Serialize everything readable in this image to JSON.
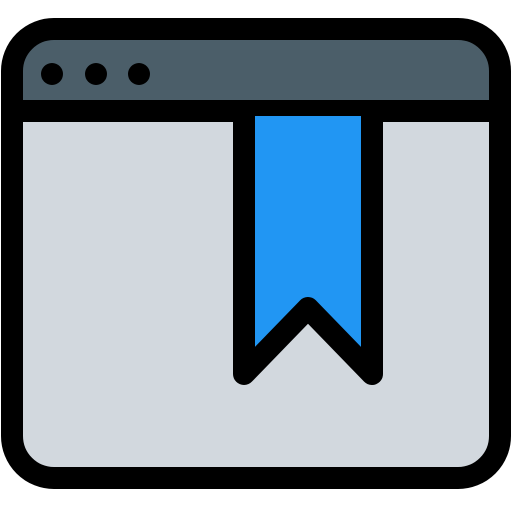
{
  "icon": {
    "name": "browser-bookmark-icon",
    "window": {
      "titlebar_color": "#4b5e69",
      "body_color": "#d2d8de",
      "outline_color": "#000000",
      "dots": [
        "window-dot-1",
        "window-dot-2",
        "window-dot-3"
      ]
    },
    "bookmark": {
      "name": "bookmark-ribbon-icon",
      "color": "#2196f3"
    }
  }
}
